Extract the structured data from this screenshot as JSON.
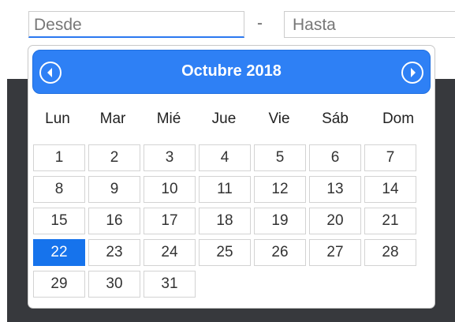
{
  "range": {
    "from_placeholder": "Desde",
    "separator": "-",
    "to_placeholder": "Hasta"
  },
  "calendar": {
    "title": "Octubre 2018",
    "prev_icon": "chevron-left-circle-icon",
    "next_icon": "chevron-right-circle-icon",
    "weekdays": [
      "Lun",
      "Mar",
      "Mié",
      "Jue",
      "Vie",
      "Sáb",
      "Dom"
    ],
    "weeks": [
      [
        "1",
        "2",
        "3",
        "4",
        "5",
        "6",
        "7"
      ],
      [
        "8",
        "9",
        "10",
        "11",
        "12",
        "13",
        "14"
      ],
      [
        "15",
        "16",
        "17",
        "18",
        "19",
        "20",
        "21"
      ],
      [
        "22",
        "23",
        "24",
        "25",
        "26",
        "27",
        "28"
      ],
      [
        "29",
        "30",
        "31",
        "",
        "",
        "",
        ""
      ]
    ],
    "selected_day": "22",
    "colors": {
      "header": "#2e80f5",
      "selected": "#1673ec",
      "backdrop": "#37393d"
    }
  }
}
